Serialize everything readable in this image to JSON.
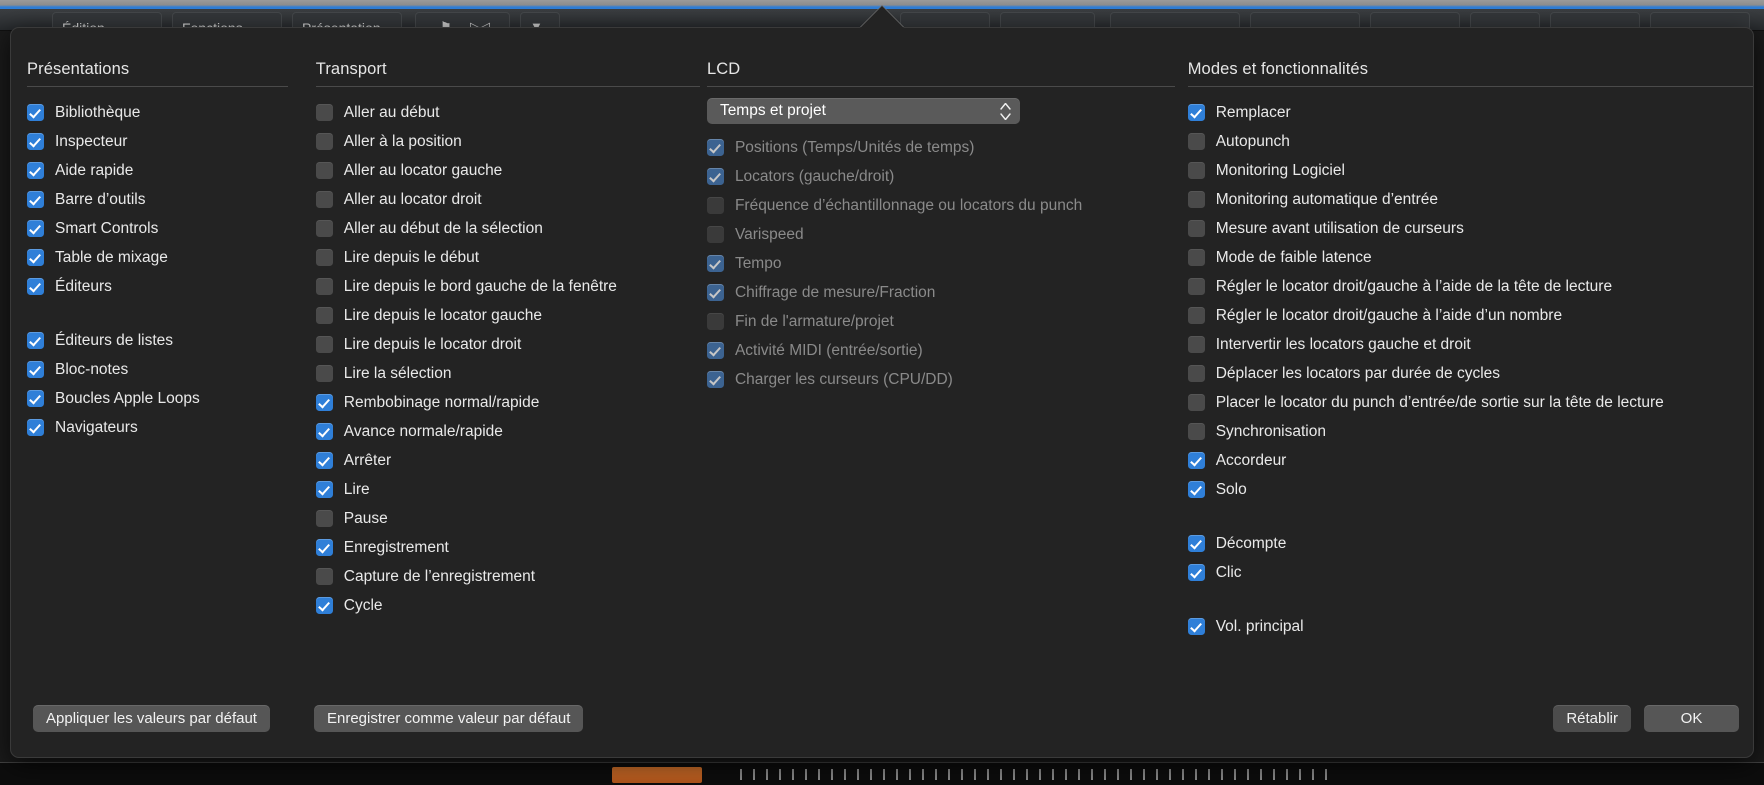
{
  "app_chrome": {
    "menu_items": [
      "Édition",
      "Fonctions",
      "Présentation"
    ],
    "toolbar_glyphs": [
      "⚑",
      "▷◁",
      "▼"
    ]
  },
  "popover": {
    "columns": [
      {
        "id": "presentations",
        "title": "Présentations",
        "items": [
          {
            "label": "Bibliothèque",
            "checked": true,
            "enabled": true
          },
          {
            "label": "Inspecteur",
            "checked": true,
            "enabled": true
          },
          {
            "label": "Aide rapide",
            "checked": true,
            "enabled": true
          },
          {
            "label": "Barre d’outils",
            "checked": true,
            "enabled": true
          },
          {
            "label": "Smart Controls",
            "checked": true,
            "enabled": true
          },
          {
            "label": "Table de mixage",
            "checked": true,
            "enabled": true
          },
          {
            "label": "Éditeurs",
            "checked": true,
            "enabled": true
          },
          {
            "spacer": true
          },
          {
            "label": "Éditeurs de listes",
            "checked": true,
            "enabled": true
          },
          {
            "label": "Bloc-notes",
            "checked": true,
            "enabled": true
          },
          {
            "label": "Boucles Apple Loops",
            "checked": true,
            "enabled": true
          },
          {
            "label": "Navigateurs",
            "checked": true,
            "enabled": true
          }
        ]
      },
      {
        "id": "transport",
        "title": "Transport",
        "items": [
          {
            "label": "Aller au début",
            "checked": false,
            "enabled": true
          },
          {
            "label": "Aller à la position",
            "checked": false,
            "enabled": true
          },
          {
            "label": "Aller au locator gauche",
            "checked": false,
            "enabled": true
          },
          {
            "label": "Aller au locator droit",
            "checked": false,
            "enabled": true
          },
          {
            "label": "Aller au début de la sélection",
            "checked": false,
            "enabled": true
          },
          {
            "label": "Lire depuis le début",
            "checked": false,
            "enabled": true
          },
          {
            "label": "Lire depuis le bord gauche de la fenêtre",
            "checked": false,
            "enabled": true
          },
          {
            "label": "Lire depuis le locator gauche",
            "checked": false,
            "enabled": true
          },
          {
            "label": "Lire depuis le locator droit",
            "checked": false,
            "enabled": true
          },
          {
            "label": "Lire la sélection",
            "checked": false,
            "enabled": true
          },
          {
            "label": "Rembobinage normal/rapide",
            "checked": true,
            "enabled": true
          },
          {
            "label": "Avance normale/rapide",
            "checked": true,
            "enabled": true
          },
          {
            "label": "Arrêter",
            "checked": true,
            "enabled": true
          },
          {
            "label": "Lire",
            "checked": true,
            "enabled": true
          },
          {
            "label": "Pause",
            "checked": false,
            "enabled": true
          },
          {
            "label": "Enregistrement",
            "checked": true,
            "enabled": true
          },
          {
            "label": "Capture de l’enregistrement",
            "checked": false,
            "enabled": true
          },
          {
            "label": "Cycle",
            "checked": true,
            "enabled": true
          }
        ]
      },
      {
        "id": "lcd",
        "title": "LCD",
        "popup": {
          "value": "Temps et projet"
        },
        "items": [
          {
            "label": "Positions (Temps/Unités de temps)",
            "checked": true,
            "enabled": false
          },
          {
            "label": "Locators (gauche/droit)",
            "checked": true,
            "enabled": false
          },
          {
            "label": "Fréquence d’échantillonnage ou locators du punch",
            "checked": false,
            "enabled": false
          },
          {
            "label": "Varispeed",
            "checked": false,
            "enabled": false
          },
          {
            "label": "Tempo",
            "checked": true,
            "enabled": false
          },
          {
            "label": "Chiffrage de mesure/Fraction",
            "checked": true,
            "enabled": false
          },
          {
            "label": "Fin de l'armature/projet",
            "checked": false,
            "enabled": false
          },
          {
            "label": "Activité MIDI (entrée/sortie)",
            "checked": true,
            "enabled": false
          },
          {
            "label": "Charger les curseurs (CPU/DD)",
            "checked": true,
            "enabled": false
          }
        ]
      },
      {
        "id": "modes",
        "title": "Modes et fonctionnalités",
        "items": [
          {
            "label": "Remplacer",
            "checked": true,
            "enabled": true
          },
          {
            "label": "Autopunch",
            "checked": false,
            "enabled": true
          },
          {
            "label": "Monitoring Logiciel",
            "checked": false,
            "enabled": true
          },
          {
            "label": "Monitoring automatique d’entrée",
            "checked": false,
            "enabled": true
          },
          {
            "label": "Mesure avant utilisation de curseurs",
            "checked": false,
            "enabled": true
          },
          {
            "label": "Mode de faible latence",
            "checked": false,
            "enabled": true
          },
          {
            "label": "Régler le locator droit/gauche à l’aide de la tête de lecture",
            "checked": false,
            "enabled": true
          },
          {
            "label": "Régler le locator droit/gauche à l’aide d’un nombre",
            "checked": false,
            "enabled": true
          },
          {
            "label": "Intervertir les locators gauche et droit",
            "checked": false,
            "enabled": true
          },
          {
            "label": "Déplacer les locators par durée de cycles",
            "checked": false,
            "enabled": true
          },
          {
            "label": "Placer le locator du punch d’entrée/de sortie sur la tête de lecture",
            "checked": false,
            "enabled": true
          },
          {
            "label": "Synchronisation",
            "checked": false,
            "enabled": true
          },
          {
            "label": "Accordeur",
            "checked": true,
            "enabled": true
          },
          {
            "label": "Solo",
            "checked": true,
            "enabled": true
          },
          {
            "spacer": true
          },
          {
            "label": "Décompte",
            "checked": true,
            "enabled": true
          },
          {
            "label": "Clic",
            "checked": true,
            "enabled": true
          },
          {
            "spacer": true
          },
          {
            "label": "Vol. principal",
            "checked": true,
            "enabled": true
          }
        ]
      }
    ],
    "footer": {
      "apply_defaults": "Appliquer les valeurs par défaut",
      "save_default": "Enregistrer comme valeur par défaut",
      "restore": "Rétablir",
      "ok": "OK"
    }
  },
  "colors": {
    "accent_blue": "#2f7fd8",
    "popover_bg": "#232323",
    "checkbox_off": "#4a4a4a",
    "text": "#e9e9e9",
    "text_dim": "#8a8a8a",
    "button_bg": "#565656"
  }
}
